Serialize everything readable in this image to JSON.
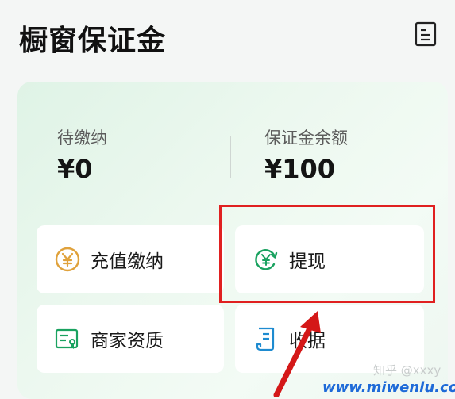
{
  "header": {
    "title": "橱窗保证金"
  },
  "summary": {
    "pending_label": "待缴纳",
    "pending_value": "¥0",
    "balance_label": "保证金余额",
    "balance_value": "¥100"
  },
  "actions": [
    {
      "label": "充值缴纳",
      "icon": "yen-coin-icon"
    },
    {
      "label": "提现",
      "icon": "withdraw-refresh-icon"
    },
    {
      "label": "商家资质",
      "icon": "certificate-icon"
    },
    {
      "label": "收据",
      "icon": "receipt-icon"
    }
  ],
  "watermark": {
    "zhihu": "知乎 @xxxy",
    "site": "www.miwenlu.com"
  },
  "colors": {
    "accent_green": "#1aa260",
    "coin_orange": "#e0a23c",
    "highlight_red": "#e02020",
    "site_blue": "#1e6ad8"
  }
}
